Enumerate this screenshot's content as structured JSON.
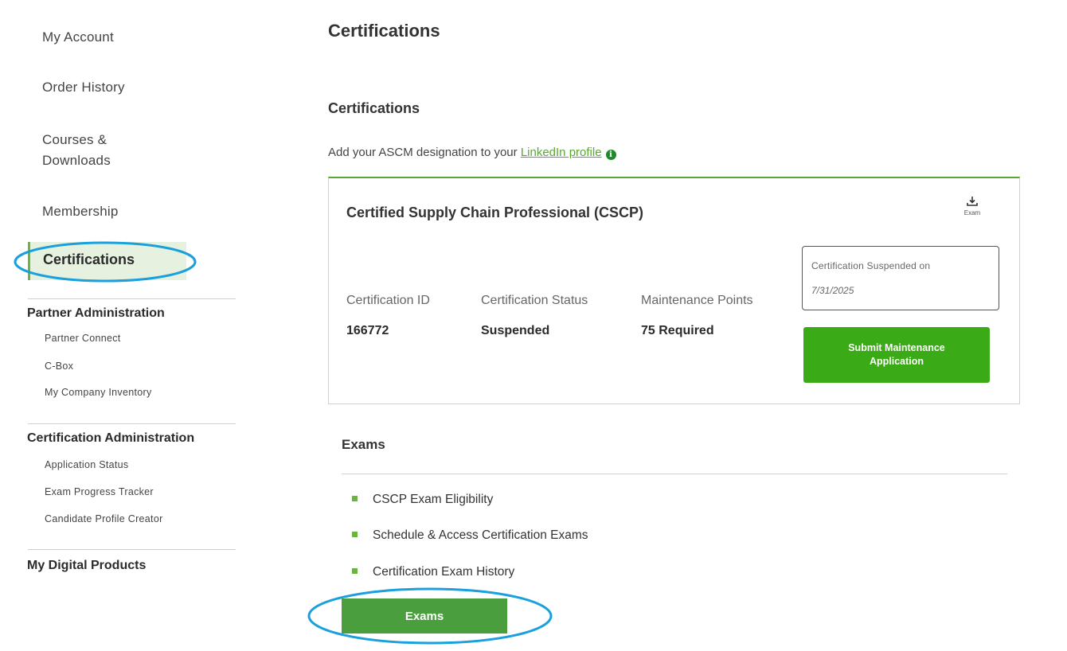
{
  "sidebar": {
    "main_items": [
      {
        "label": "My Account"
      },
      {
        "label": "Order History"
      },
      {
        "label": "Courses & Downloads"
      },
      {
        "label": "Membership"
      }
    ],
    "active_item": {
      "label": "Certifications"
    },
    "partner_admin": {
      "heading": "Partner Administration",
      "items": [
        {
          "label": "Partner Connect"
        },
        {
          "label": "C-Box"
        },
        {
          "label": "My Company Inventory"
        }
      ]
    },
    "cert_admin": {
      "heading": "Certification Administration",
      "items": [
        {
          "label": "Application Status"
        },
        {
          "label": "Exam Progress Tracker"
        },
        {
          "label": "Candidate Profile Creator"
        }
      ]
    },
    "digital_products": {
      "heading": "My Digital Products"
    }
  },
  "main": {
    "page_title": "Certifications",
    "section_title": "Certifications",
    "linkedin": {
      "prefix": "Add your ASCM designation to your ",
      "link_text": "LinkedIn profile",
      "info_icon": "info-icon"
    },
    "card": {
      "title": "Certified Supply Chain Professional (CSCP)",
      "download": {
        "icon": "download-icon",
        "label": "Exam"
      },
      "fields": [
        {
          "label": "Certification ID",
          "value": "166772"
        },
        {
          "label": "Certification Status",
          "value": "Suspended"
        },
        {
          "label": "Maintenance Points",
          "value": "75 Required"
        }
      ],
      "suspended": {
        "label": "Certification Suspended on",
        "date": "7/31/2025"
      },
      "submit_button": "Submit Maintenance Application"
    },
    "exams": {
      "title": "Exams",
      "items": [
        {
          "label": "CSCP Exam Eligibility"
        },
        {
          "label": "Schedule & Access Certification Exams"
        },
        {
          "label": "Certification Exam History"
        }
      ],
      "button": "Exams"
    }
  },
  "colors": {
    "accent_green": "#5aa832",
    "button_green": "#3aaa16",
    "exams_button_green": "#4a9e3e",
    "active_nav_bg": "#e6f2df",
    "annotation_blue": "#1aa0dc"
  }
}
